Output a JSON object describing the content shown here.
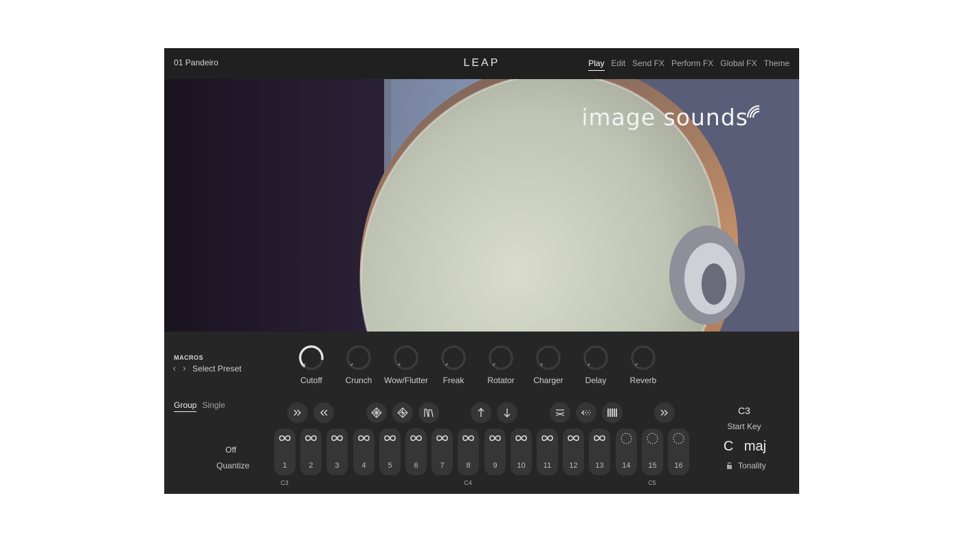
{
  "header": {
    "preset_name": "01 Pandeiro",
    "logo_text": "LEAP",
    "nav_tabs": [
      {
        "label": "Play",
        "active": true
      },
      {
        "label": "Edit",
        "active": false
      },
      {
        "label": "Send FX",
        "active": false
      },
      {
        "label": "Perform FX",
        "active": false
      },
      {
        "label": "Global FX",
        "active": false
      },
      {
        "label": "Theme",
        "active": false
      }
    ]
  },
  "hero": {
    "brand_text": "image sounds",
    "brand_icon": "wifi-waves-icon"
  },
  "macros": {
    "title": "MACROS",
    "preset_placeholder": "Select Preset",
    "knobs": [
      {
        "label": "Cutoff",
        "value": 0.85
      },
      {
        "label": "Crunch",
        "value": 0.0
      },
      {
        "label": "Wow/Flutter",
        "value": 0.0
      },
      {
        "label": "Freak",
        "value": 0.0
      },
      {
        "label": "Rotator",
        "value": 0.0
      },
      {
        "label": "Charger",
        "value": 0.0
      },
      {
        "label": "Delay",
        "value": 0.0
      },
      {
        "label": "Reverb",
        "value": 0.0
      }
    ]
  },
  "mode": {
    "tabs": [
      {
        "label": "Group",
        "active": true
      },
      {
        "label": "Single",
        "active": false
      }
    ]
  },
  "quantize": {
    "value": "Off",
    "label": "Quantize"
  },
  "pattern_buttons": [
    {
      "icon": "double-chevron-right-icon"
    },
    {
      "icon": "double-chevron-left-icon"
    },
    {
      "icon": "grid-diamond-icon"
    },
    {
      "icon": "grid-diamond-alt-icon"
    },
    {
      "icon": "envelope-shape-icon"
    },
    {
      "icon": "arrow-up-icon"
    },
    {
      "icon": "arrow-down-icon"
    },
    {
      "icon": "swap-lines-icon"
    },
    {
      "icon": "dotted-arrow-icon"
    },
    {
      "icon": "bars-icon"
    },
    {
      "icon": "double-chevron-right-icon"
    }
  ],
  "pads": [
    {
      "number": "1",
      "icon": "infinity-icon"
    },
    {
      "number": "2",
      "icon": "infinity-icon"
    },
    {
      "number": "3",
      "icon": "infinity-icon"
    },
    {
      "number": "4",
      "icon": "infinity-icon"
    },
    {
      "number": "5",
      "icon": "infinity-icon"
    },
    {
      "number": "6",
      "icon": "infinity-icon"
    },
    {
      "number": "7",
      "icon": "infinity-icon"
    },
    {
      "number": "8",
      "icon": "infinity-icon"
    },
    {
      "number": "9",
      "icon": "infinity-icon"
    },
    {
      "number": "10",
      "icon": "infinity-icon"
    },
    {
      "number": "11",
      "icon": "infinity-icon"
    },
    {
      "number": "12",
      "icon": "infinity-icon"
    },
    {
      "number": "13",
      "icon": "infinity-icon"
    },
    {
      "number": "14",
      "icon": "dotted-circle-icon"
    },
    {
      "number": "15",
      "icon": "dotted-circle-icon"
    },
    {
      "number": "16",
      "icon": "dotted-circle-icon"
    }
  ],
  "note_labels": {
    "c3": "C3",
    "c4": "C4",
    "c5": "C5"
  },
  "start_key": {
    "value": "C3",
    "label": "Start Key"
  },
  "tonality": {
    "value": "C maj",
    "label": "Tonality",
    "lock_icon": "lock-icon"
  },
  "colors": {
    "background": "#262626",
    "header": "#202020",
    "pad": "#363636",
    "text": "#cfcfcf"
  }
}
